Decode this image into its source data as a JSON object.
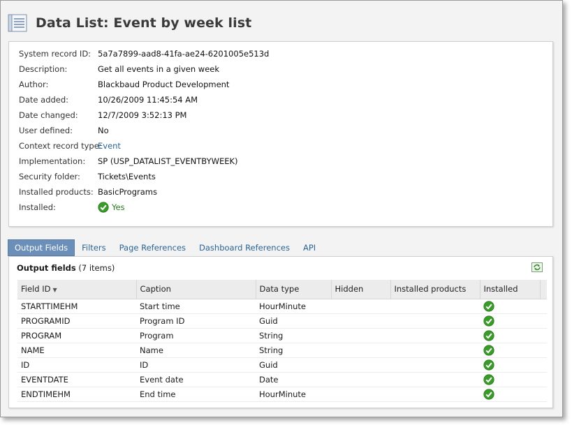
{
  "page": {
    "title": "Data List: Event by week list"
  },
  "info": [
    {
      "label": "System record ID:",
      "value": "5a7a7899-aad8-41fa-ae24-6201005e513d"
    },
    {
      "label": "Description:",
      "value": "Get all events in a given week"
    },
    {
      "label": "Author:",
      "value": "Blackbaud Product Development"
    },
    {
      "label": "Date added:",
      "value": "10/26/2009 11:45:54 AM"
    },
    {
      "label": "Date changed:",
      "value": "12/7/2009 3:52:13 PM"
    },
    {
      "label": "User defined:",
      "value": "No"
    },
    {
      "label": "Context record type:",
      "value": "Event"
    },
    {
      "label": "Implementation:",
      "value": "SP (USP_DATALIST_EVENTBYWEEK)"
    },
    {
      "label": "Security folder:",
      "value": "Tickets\\Events"
    },
    {
      "label": "Installed products:",
      "value": "BasicPrograms"
    },
    {
      "label": "Installed:",
      "value": "Yes",
      "icon": "green-check-icon"
    }
  ],
  "tabs": [
    "Output Fields",
    "Filters",
    "Page References",
    "Dashboard References",
    "API"
  ],
  "active_tab": "Output Fields",
  "grid": {
    "title": "Output fields",
    "count": "(7 items)",
    "columns": [
      "Field ID",
      "Caption",
      "Data type",
      "Hidden",
      "Installed products",
      "Installed"
    ],
    "rows": [
      {
        "field_id": "STARTTIMEHM",
        "caption": "Start time",
        "data_type": "HourMinute",
        "hidden": "",
        "installed_products": "",
        "installed": true
      },
      {
        "field_id": "PROGRAMID",
        "caption": "Program ID",
        "data_type": "Guid",
        "hidden": "",
        "installed_products": "",
        "installed": true
      },
      {
        "field_id": "PROGRAM",
        "caption": "Program",
        "data_type": "String",
        "hidden": "",
        "installed_products": "",
        "installed": true
      },
      {
        "field_id": "NAME",
        "caption": "Name",
        "data_type": "String",
        "hidden": "",
        "installed_products": "",
        "installed": true
      },
      {
        "field_id": "ID",
        "caption": "ID",
        "data_type": "Guid",
        "hidden": "",
        "installed_products": "",
        "installed": true
      },
      {
        "field_id": "EVENTDATE",
        "caption": "Event date",
        "data_type": "Date",
        "hidden": "",
        "installed_products": "",
        "installed": true
      },
      {
        "field_id": "ENDTIMEHM",
        "caption": "End time",
        "data_type": "HourMinute",
        "hidden": "",
        "installed_products": "",
        "installed": true
      }
    ]
  },
  "colors": {
    "link": "#2a6496",
    "active_tab": "#6b8fb8",
    "check_green": "#3a9a2a"
  }
}
